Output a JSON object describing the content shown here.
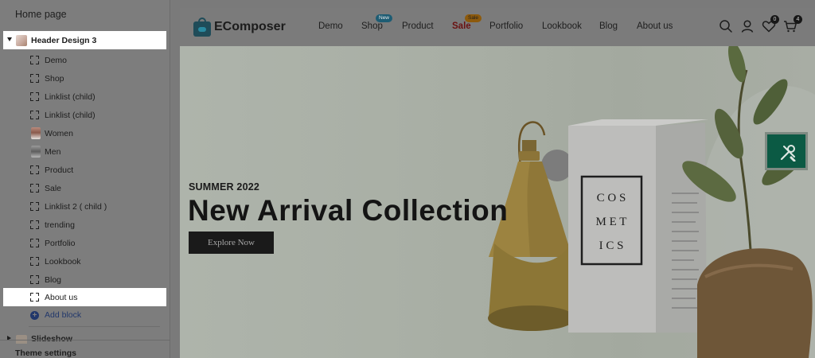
{
  "sidebar": {
    "title": "Home page",
    "section": "Header Design 3",
    "items": [
      "Demo",
      "Shop",
      "Linklist (child)",
      "Linklist (child)",
      "Women",
      "Men",
      "Product",
      "Sale",
      "Linklist 2 ( child )",
      "trending",
      "Portfolio",
      "Lookbook",
      "Blog",
      "About us"
    ],
    "add_block": "Add block",
    "next_section": "Slideshow",
    "theme_settings": "Theme settings"
  },
  "header": {
    "logo_text": "EComposer",
    "nav": [
      "Demo",
      "Shop",
      "Product",
      "Sale",
      "Portfolio",
      "Lookbook",
      "Blog",
      "About us"
    ],
    "badge_new": "New",
    "badge_sale": "Sale",
    "wishlist_count": "0",
    "cart_count": "4"
  },
  "hero": {
    "eyebrow": "SUMMER 2022",
    "headline": "New Arrival Collection",
    "button": "Explore Now",
    "box_text": [
      "C O S",
      "M E T",
      "I C S"
    ]
  },
  "colors": {
    "sidebar_highlight": "#ffffff",
    "add_block": "#22386b",
    "accent_green": "#0b5a44",
    "sale": "#6a1111"
  }
}
